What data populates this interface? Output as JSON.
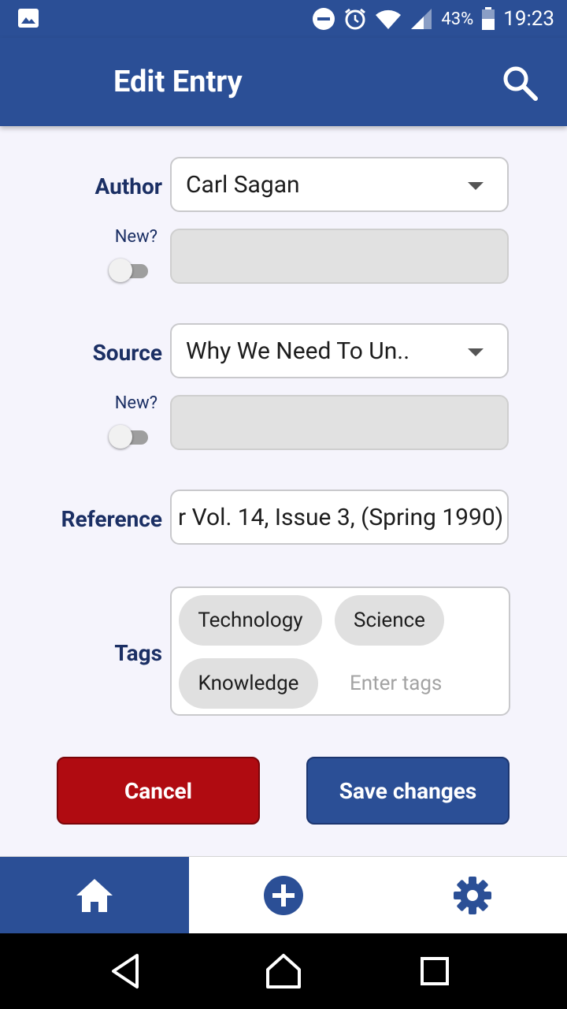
{
  "status_bar": {
    "battery": "43%",
    "time": "19:23",
    "icons": [
      "image-icon",
      "do-not-disturb-icon",
      "alarm-icon",
      "wifi-icon",
      "signal-icon",
      "battery-icon"
    ]
  },
  "app_bar": {
    "title": "Edit Entry",
    "search_icon": "search-icon"
  },
  "form": {
    "author": {
      "label": "Author",
      "value": "Carl Sagan",
      "new_label": "New?",
      "new_value": ""
    },
    "source": {
      "label": "Source",
      "value": "Why We Need To Un..",
      "new_label": "New?",
      "new_value": ""
    },
    "reference": {
      "label": "Reference",
      "value": "r Vol. 14, Issue 3, (Spring 1990)"
    },
    "tags": {
      "label": "Tags",
      "chips": [
        "Technology",
        "Science",
        "Knowledge"
      ],
      "placeholder": "Enter tags"
    }
  },
  "actions": {
    "cancel": "Cancel",
    "save": "Save changes"
  },
  "bottom_nav": {
    "items": [
      "home-icon",
      "add-circle-icon",
      "settings-gear-icon"
    ],
    "active": 0
  },
  "colors": {
    "primary": "#2b4f96",
    "danger": "#b00b11",
    "label": "#1b2f64",
    "background": "#f5f4fc"
  }
}
